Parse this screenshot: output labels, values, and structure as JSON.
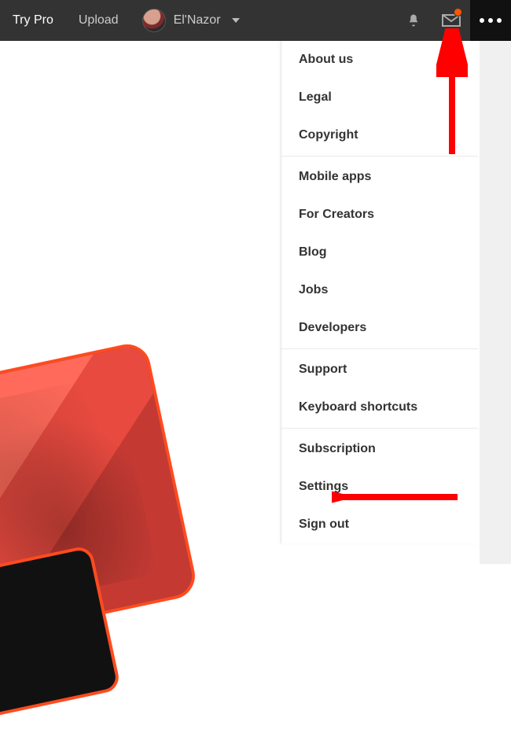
{
  "nav": {
    "try_pro": "Try Pro",
    "upload": "Upload",
    "username": "El'Nazor"
  },
  "menu": {
    "groups": [
      [
        "About us",
        "Legal",
        "Copyright"
      ],
      [
        "Mobile apps",
        "For Creators",
        "Blog",
        "Jobs",
        "Developers"
      ],
      [
        "Support",
        "Keyboard shortcuts"
      ],
      [
        "Subscription",
        "Settings",
        "Sign out"
      ]
    ]
  },
  "annotations": {
    "arrow1_target": "more-menu-button",
    "arrow2_target": "menu-item-settings",
    "arrow_color": "#ff0000"
  }
}
